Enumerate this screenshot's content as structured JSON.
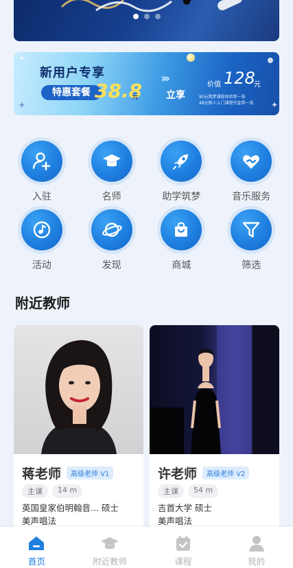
{
  "carousel": {
    "deco_text": "",
    "dots": 3,
    "active_dot": 0
  },
  "promo": {
    "title": "新用户专享",
    "pill": "特惠套餐",
    "price": "38.8",
    "price_unit": "元",
    "share": "立享",
    "value_label": "价值",
    "value": "128",
    "value_unit": "元",
    "desc_line1": "80元筑梦课程体验券一张",
    "desc_line2": "48元新人入门课程代金券一张"
  },
  "grid": [
    {
      "label": "入驻",
      "icon": "user-plus-icon"
    },
    {
      "label": "名师",
      "icon": "graduation-cap-icon"
    },
    {
      "label": "助学筑梦",
      "icon": "rocket-icon"
    },
    {
      "label": "音乐服务",
      "icon": "heart-handshake-icon"
    },
    {
      "label": "活动",
      "icon": "music-note-icon"
    },
    {
      "label": "发现",
      "icon": "planet-icon"
    },
    {
      "label": "商城",
      "icon": "shopping-bag-icon"
    },
    {
      "label": "筛选",
      "icon": "filter-icon"
    }
  ],
  "section": {
    "title": "附近教师"
  },
  "teachers": [
    {
      "name": "蒋老师",
      "level": "高级老师 V1",
      "tag": "主课",
      "distance": "14 m",
      "school": "英国皇家伯明翰音... 硕士",
      "major": "美声唱法"
    },
    {
      "name": "许老师",
      "level": "高级老师 V2",
      "tag": "主课",
      "distance": "54 m",
      "school": "吉首大学 硕士",
      "major": "美声唱法"
    }
  ],
  "tabs": [
    {
      "label": "首页",
      "icon": "home-icon",
      "active": true
    },
    {
      "label": "附近教师",
      "icon": "graduation-cap-icon",
      "active": false
    },
    {
      "label": "课程",
      "icon": "calendar-check-icon",
      "active": false
    },
    {
      "label": "我的",
      "icon": "person-icon",
      "active": false
    }
  ],
  "colors": {
    "accent": "#1f7fe0",
    "background": "#eef3fb",
    "inactive_tab": "#b5b5b5"
  }
}
